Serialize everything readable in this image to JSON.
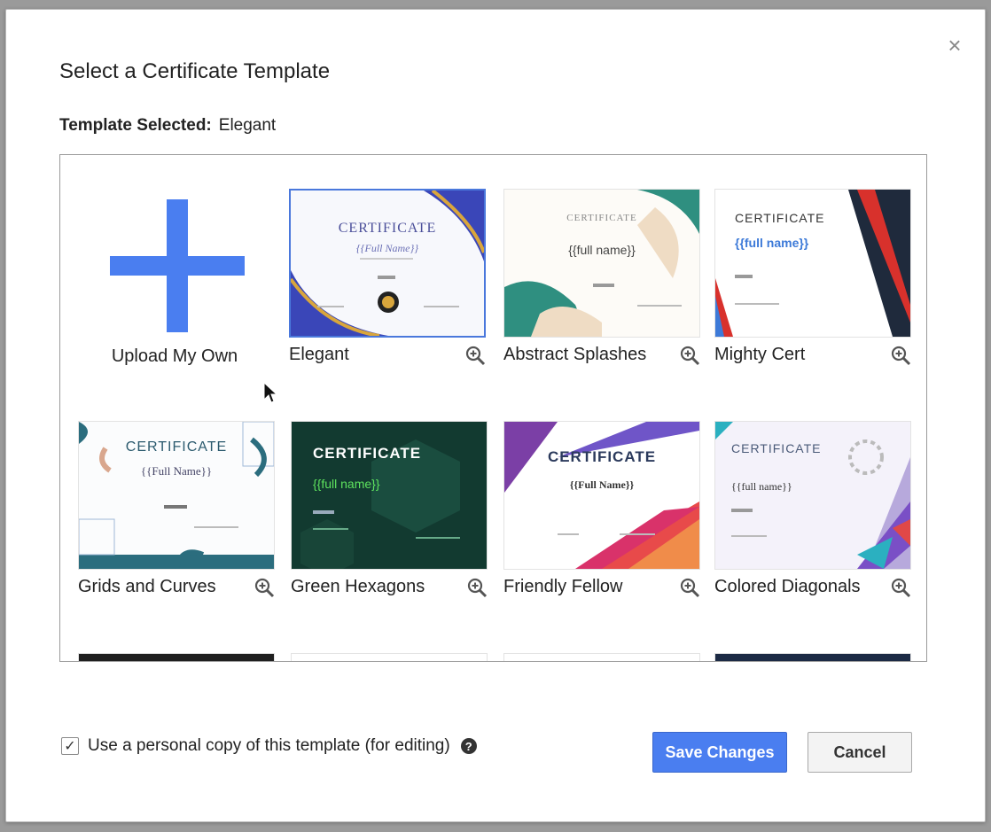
{
  "dialog": {
    "title": "Select a Certificate Template",
    "close_symbol": "×",
    "selected_label": "Template Selected:",
    "selected_value": "Elegant"
  },
  "upload": {
    "label": "Upload My Own",
    "icon": "plus-icon"
  },
  "templates": [
    {
      "name": "Elegant",
      "cert_title": "CERTIFICATE",
      "cert_name": "{{Full Name}}"
    },
    {
      "name": "Abstract Splashes",
      "cert_title": "CERTIFICATE",
      "cert_name": "{{full name}}"
    },
    {
      "name": "Mighty Cert",
      "cert_title": "CERTIFICATE",
      "cert_name": "{{full name}}"
    },
    {
      "name": "Grids and Curves",
      "cert_title": "CERTIFICATE",
      "cert_name": "{{Full Name}}"
    },
    {
      "name": "Green Hexagons",
      "cert_title": "CERTIFICATE",
      "cert_name": "{{full name}}"
    },
    {
      "name": "Friendly Fellow",
      "cert_title": "CERTIFICATE",
      "cert_name": "{{Full Name}}"
    },
    {
      "name": "Colored Diagonals",
      "cert_title": "CERTIFICATE",
      "cert_name": "{{full name}}"
    }
  ],
  "footer": {
    "checkbox_checked": true,
    "checkbox_label": "Use a personal copy of this template (for editing)",
    "help_symbol": "?",
    "save_label": "Save Changes",
    "cancel_label": "Cancel"
  },
  "colors": {
    "accent": "#4a7ef0",
    "selected_border": "#4a78dc"
  }
}
